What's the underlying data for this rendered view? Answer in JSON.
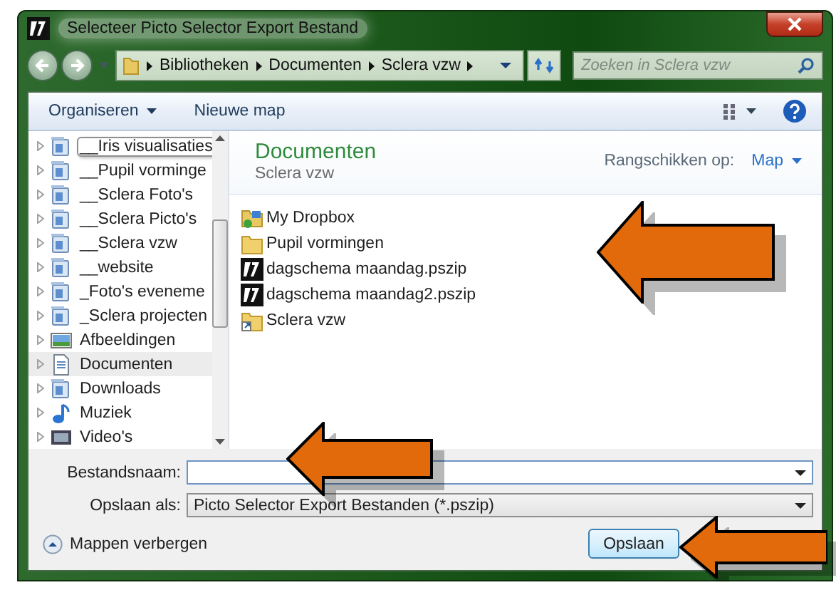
{
  "window": {
    "title": "Selecteer Picto Selector Export Bestand"
  },
  "address": {
    "crumbs": [
      "Bibliotheken",
      "Documenten",
      "Sclera vzw"
    ],
    "search_placeholder": "Zoeken in Sclera vzw"
  },
  "toolbar": {
    "organize": "Organiseren",
    "new_folder": "Nieuwe map"
  },
  "sidebar": {
    "items": [
      {
        "label": "__Iris visualisaties",
        "kind": "library",
        "selected": false,
        "hovered": true
      },
      {
        "label": "__Pupil vorminge",
        "kind": "library",
        "selected": false,
        "hovered": false
      },
      {
        "label": "__Sclera Foto's",
        "kind": "library",
        "selected": false,
        "hovered": false
      },
      {
        "label": "__Sclera Picto's",
        "kind": "library",
        "selected": false,
        "hovered": false
      },
      {
        "label": "__Sclera vzw",
        "kind": "library",
        "selected": false,
        "hovered": false
      },
      {
        "label": "__website",
        "kind": "library",
        "selected": false,
        "hovered": false
      },
      {
        "label": "_Foto's eveneme",
        "kind": "library",
        "selected": false,
        "hovered": false
      },
      {
        "label": "_Sclera projecten",
        "kind": "library",
        "selected": false,
        "hovered": false
      },
      {
        "label": "Afbeeldingen",
        "kind": "pictures",
        "selected": false,
        "hovered": false
      },
      {
        "label": "Documenten",
        "kind": "documents",
        "selected": true,
        "hovered": false
      },
      {
        "label": "Downloads",
        "kind": "library",
        "selected": false,
        "hovered": false
      },
      {
        "label": "Muziek",
        "kind": "music",
        "selected": false,
        "hovered": false
      },
      {
        "label": "Video's",
        "kind": "videos",
        "selected": false,
        "hovered": false
      }
    ]
  },
  "content": {
    "title": "Documenten",
    "subtitle": "Sclera vzw",
    "arrange_label": "Rangschikken op:",
    "arrange_value": "Map",
    "files": [
      {
        "name": "My Dropbox",
        "kind": "dropbox"
      },
      {
        "name": "Pupil vormingen",
        "kind": "folder"
      },
      {
        "name": "dagschema maandag.pszip",
        "kind": "pszip"
      },
      {
        "name": "dagschema maandag2.pszip",
        "kind": "pszip"
      },
      {
        "name": "Sclera vzw",
        "kind": "shortcut"
      }
    ]
  },
  "form": {
    "filename_label": "Bestandsnaam:",
    "type_label": "Opslaan als:",
    "type_value": "Picto Selector Export Bestanden (*.pszip)"
  },
  "footer": {
    "hide_folders": "Mappen verbergen",
    "save": "Opslaan"
  }
}
